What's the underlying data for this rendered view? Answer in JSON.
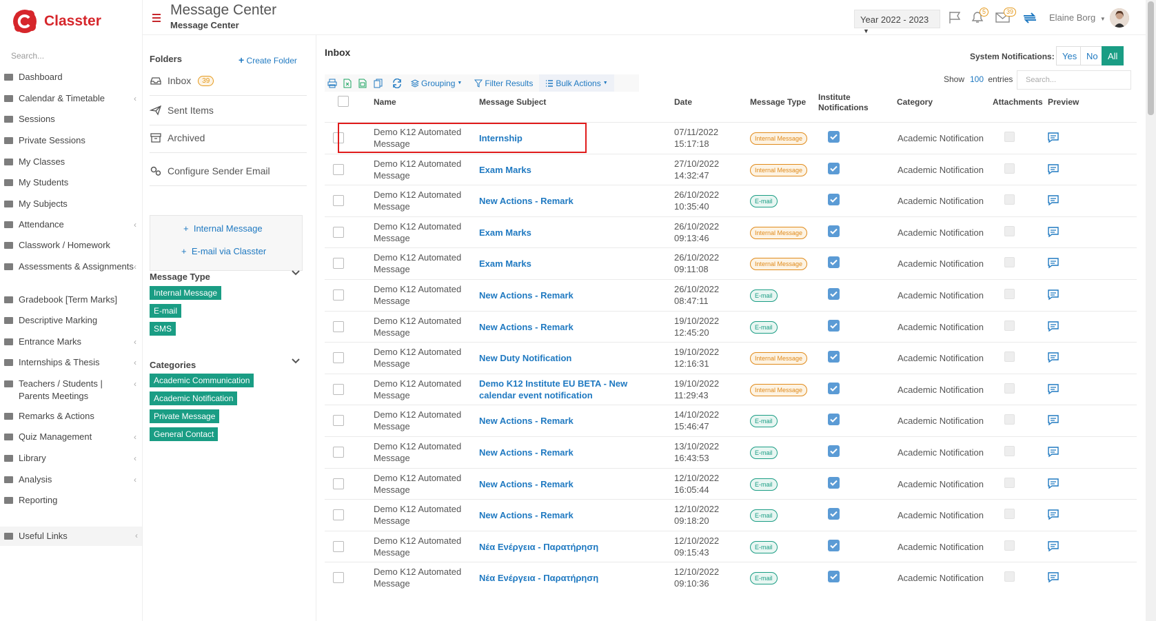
{
  "app": {
    "brand": "Classter"
  },
  "sidebar": {
    "search_placeholder": "Search...",
    "items": [
      {
        "label": "Dashboard",
        "icon": "laptop-icon",
        "chevron": false
      },
      {
        "label": "Calendar & Timetable",
        "icon": "calendar-icon",
        "chevron": true
      },
      {
        "label": "Sessions",
        "icon": "sessions-icon",
        "chevron": false
      },
      {
        "label": "Private Sessions",
        "icon": "private-sessions-icon",
        "chevron": false
      },
      {
        "label": "My Classes",
        "icon": "classes-icon",
        "chevron": false
      },
      {
        "label": "My Students",
        "icon": "students-icon",
        "chevron": false
      },
      {
        "label": "My Subjects",
        "icon": "book-icon",
        "chevron": false
      },
      {
        "label": "Attendance",
        "icon": "attendance-icon",
        "chevron": true
      },
      {
        "label": "Classwork / Homework",
        "icon": "list-icon",
        "chevron": false
      },
      {
        "label": "Assessments & Assignments",
        "icon": "edit-icon",
        "chevron": true
      },
      {
        "label": "Gradebook [Term Marks]",
        "icon": "gradebook-icon",
        "chevron": false
      },
      {
        "label": "Descriptive Marking",
        "icon": "marking-icon",
        "chevron": false
      },
      {
        "label": "Entrance Marks",
        "icon": "clipboard-icon",
        "chevron": true
      },
      {
        "label": "Internships & Thesis",
        "icon": "cube-icon",
        "chevron": true
      },
      {
        "label": "Teachers / Students | Parents Meetings",
        "icon": "meetings-icon",
        "chevron": true
      },
      {
        "label": "Remarks & Actions",
        "icon": "remarks-icon",
        "chevron": false
      },
      {
        "label": "Quiz Management",
        "icon": "quiz-icon",
        "chevron": true
      },
      {
        "label": "Library",
        "icon": "library-icon",
        "chevron": true
      },
      {
        "label": "Analysis",
        "icon": "bar-chart-icon",
        "chevron": true
      },
      {
        "label": "Reporting",
        "icon": "printer-icon",
        "chevron": false
      },
      {
        "label": "Useful Links",
        "icon": "link-icon",
        "chevron": true
      }
    ]
  },
  "header": {
    "title": "Message Center",
    "subtitle": "Message Center",
    "year": "Year 2022 - 2023",
    "bell_badge": "5",
    "mail_badge": "39",
    "user_name": "Elaine Borg"
  },
  "folders": {
    "heading": "Folders",
    "create_label": "Create Folder",
    "items": [
      {
        "label": "Inbox",
        "badge": "39"
      },
      {
        "label": "Sent Items"
      },
      {
        "label": "Archived"
      },
      {
        "label": "Configure Sender Email"
      }
    ],
    "compose": [
      "Internal Message",
      "E-mail via Classter"
    ],
    "message_type_heading": "Message Type",
    "message_types": [
      "Internal Message",
      "E-mail",
      "SMS"
    ],
    "categories_heading": "Categories",
    "categories": [
      "Academic Communication",
      "Academic Notification",
      "Private Message",
      "General Contact"
    ]
  },
  "inbox": {
    "title": "Inbox",
    "system_notifications_label": "System Notifications:",
    "system_notifications_options": [
      "Yes",
      "No",
      "All"
    ],
    "system_notifications_selected": "All",
    "toolbar": {
      "grouping": "Grouping",
      "filter": "Filter Results",
      "bulk": "Bulk Actions"
    },
    "show_label": "Show",
    "show_value": "100",
    "entries_label": "entries",
    "search_placeholder": "Search...",
    "columns": {
      "name": "Name",
      "subject": "Message Subject",
      "date": "Date",
      "type": "Message Type",
      "institute": "Institute Notifications",
      "category": "Category",
      "attachments": "Attachments",
      "preview": "Preview"
    },
    "rows": [
      {
        "name": "Demo K12 Automated Message",
        "subject": "Internship",
        "date": "07/11/2022",
        "time": "15:17:18",
        "type": "Internal Message",
        "category": "Academic Notification"
      },
      {
        "name": "Demo K12 Automated Message",
        "subject": "Exam Marks",
        "date": "27/10/2022",
        "time": "14:32:47",
        "type": "Internal Message",
        "category": "Academic Notification"
      },
      {
        "name": "Demo K12 Automated Message",
        "subject": "New Actions - Remark",
        "date": "26/10/2022",
        "time": "10:35:40",
        "type": "E-mail",
        "category": "Academic Notification"
      },
      {
        "name": "Demo K12 Automated Message",
        "subject": "Exam Marks",
        "date": "26/10/2022",
        "time": "09:13:46",
        "type": "Internal Message",
        "category": "Academic Notification"
      },
      {
        "name": "Demo K12 Automated Message",
        "subject": "Exam Marks",
        "date": "26/10/2022",
        "time": "09:11:08",
        "type": "Internal Message",
        "category": "Academic Notification"
      },
      {
        "name": "Demo K12 Automated Message",
        "subject": "New Actions - Remark",
        "date": "26/10/2022",
        "time": "08:47:11",
        "type": "E-mail",
        "category": "Academic Notification"
      },
      {
        "name": "Demo K12 Automated Message",
        "subject": "New Actions - Remark",
        "date": "19/10/2022",
        "time": "12:45:20",
        "type": "E-mail",
        "category": "Academic Notification"
      },
      {
        "name": "Demo K12 Automated Message",
        "subject": "New Duty Notification",
        "date": "19/10/2022",
        "time": "12:16:31",
        "type": "Internal Message",
        "category": "Academic Notification"
      },
      {
        "name": "Demo K12 Automated Message",
        "subject": "Demo K12 Institute EU BETA - New calendar event notification",
        "date": "19/10/2022",
        "time": "11:29:43",
        "type": "Internal Message",
        "category": "Academic Notification"
      },
      {
        "name": "Demo K12 Automated Message",
        "subject": "New Actions - Remark",
        "date": "14/10/2022",
        "time": "15:46:47",
        "type": "E-mail",
        "category": "Academic Notification"
      },
      {
        "name": "Demo K12 Automated Message",
        "subject": "New Actions - Remark",
        "date": "13/10/2022",
        "time": "16:43:53",
        "type": "E-mail",
        "category": "Academic Notification"
      },
      {
        "name": "Demo K12 Automated Message",
        "subject": "New Actions - Remark",
        "date": "12/10/2022",
        "time": "16:05:44",
        "type": "E-mail",
        "category": "Academic Notification"
      },
      {
        "name": "Demo K12 Automated Message",
        "subject": "New Actions - Remark",
        "date": "12/10/2022",
        "time": "09:18:20",
        "type": "E-mail",
        "category": "Academic Notification"
      },
      {
        "name": "Demo K12 Automated Message",
        "subject": "Νέα Ενέργεια - Παρατήρηση",
        "date": "12/10/2022",
        "time": "09:15:43",
        "type": "E-mail",
        "category": "Academic Notification"
      },
      {
        "name": "Demo K12 Automated Message",
        "subject": "Νέα Ενέργεια - Παρατήρηση",
        "date": "12/10/2022",
        "time": "09:10:36",
        "type": "E-mail",
        "category": "Academic Notification"
      }
    ]
  },
  "colors": {
    "brand_red": "#d6262b",
    "link_blue": "#1f79c1",
    "teal": "#1a9d84",
    "orange": "#e08a1a",
    "highlight": "#e01a1a"
  }
}
